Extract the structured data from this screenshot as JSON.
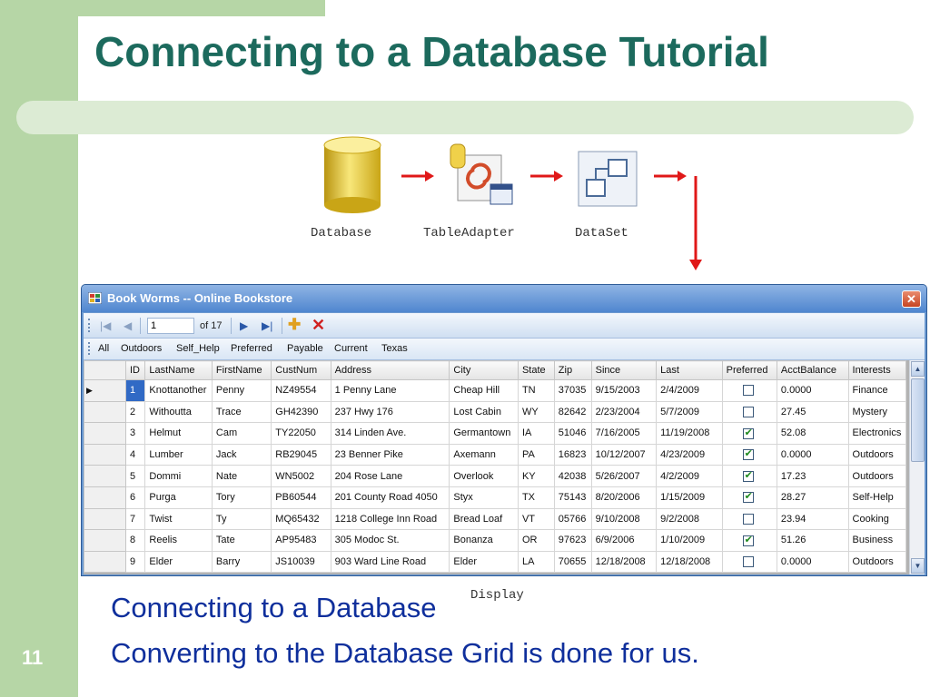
{
  "slide": {
    "title": "Connecting to a Database Tutorial",
    "page_number": "11",
    "bullets": [
      "Connecting to a Database",
      "Converting to the Database Grid is done for us."
    ]
  },
  "flow": {
    "database_label": "Database",
    "table_adapter_label": "TableAdapter",
    "dataset_label": "DataSet",
    "display_label": "Display",
    "arrow_color": "#e01818"
  },
  "window": {
    "title": "Book Worms -- Online Bookstore",
    "close_glyph": "✕",
    "navigator": {
      "position": "1",
      "count_text": "of 17"
    },
    "filters": [
      "All",
      "Outdoors",
      "Self_Help",
      "Preferred",
      "Payable",
      "Current",
      "Texas"
    ],
    "grid": {
      "columns": [
        "ID",
        "LastName",
        "FirstName",
        "CustNum",
        "Address",
        "City",
        "State",
        "Zip",
        "Since",
        "Last",
        "Preferred",
        "AcctBalance",
        "Interests"
      ],
      "rows": [
        {
          "id": "1",
          "last": "Knottanother",
          "first": "Penny",
          "cust": "NZ49554",
          "address": "1 Penny Lane",
          "city": "Cheap Hill",
          "state": "TN",
          "zip": "37035",
          "since": "9/15/2003",
          "lastdate": "2/4/2009",
          "preferred": false,
          "balance": "0.0000",
          "interests": "Finance"
        },
        {
          "id": "2",
          "last": "Withoutta",
          "first": "Trace",
          "cust": "GH42390",
          "address": "237 Hwy 176",
          "city": "Lost Cabin",
          "state": "WY",
          "zip": "82642",
          "since": "2/23/2004",
          "lastdate": "5/7/2009",
          "preferred": false,
          "balance": "27.45",
          "interests": "Mystery"
        },
        {
          "id": "3",
          "last": "Helmut",
          "first": "Cam",
          "cust": "TY22050",
          "address": "314 Linden Ave.",
          "city": "Germantown",
          "state": "IA",
          "zip": "51046",
          "since": "7/16/2005",
          "lastdate": "11/19/2008",
          "preferred": true,
          "balance": "52.08",
          "interests": "Electronics"
        },
        {
          "id": "4",
          "last": "Lumber",
          "first": "Jack",
          "cust": "RB29045",
          "address": "23 Benner Pike",
          "city": "Axemann",
          "state": "PA",
          "zip": "16823",
          "since": "10/12/2007",
          "lastdate": "4/23/2009",
          "preferred": true,
          "balance": "0.0000",
          "interests": "Outdoors"
        },
        {
          "id": "5",
          "last": "Dommi",
          "first": "Nate",
          "cust": "WN5002",
          "address": "204 Rose Lane",
          "city": "Overlook",
          "state": "KY",
          "zip": "42038",
          "since": "5/26/2007",
          "lastdate": "4/2/2009",
          "preferred": true,
          "balance": "17.23",
          "interests": "Outdoors"
        },
        {
          "id": "6",
          "last": "Purga",
          "first": "Tory",
          "cust": "PB60544",
          "address": "201 County Road 4050",
          "city": "Styx",
          "state": "TX",
          "zip": "75143",
          "since": "8/20/2006",
          "lastdate": "1/15/2009",
          "preferred": true,
          "balance": "28.27",
          "interests": "Self-Help"
        },
        {
          "id": "7",
          "last": "Twist",
          "first": "Ty",
          "cust": "MQ65432",
          "address": "1218 College Inn Road",
          "city": "Bread Loaf",
          "state": "VT",
          "zip": "05766",
          "since": "9/10/2008",
          "lastdate": "9/2/2008",
          "preferred": false,
          "balance": "23.94",
          "interests": "Cooking"
        },
        {
          "id": "8",
          "last": "Reelis",
          "first": "Tate",
          "cust": "AP95483",
          "address": "305 Modoc St.",
          "city": "Bonanza",
          "state": "OR",
          "zip": "97623",
          "since": "6/9/2006",
          "lastdate": "1/10/2009",
          "preferred": true,
          "balance": "51.26",
          "interests": "Business"
        },
        {
          "id": "9",
          "last": "Elder",
          "first": "Barry",
          "cust": "JS10039",
          "address": "903 Ward Line Road",
          "city": "Elder",
          "state": "LA",
          "zip": "70655",
          "since": "12/18/2008",
          "lastdate": "12/18/2008",
          "preferred": false,
          "balance": "0.0000",
          "interests": "Outdoors"
        }
      ]
    }
  },
  "colors": {
    "title": "#1c6a5d",
    "accent_green": "#b6d6a6",
    "bullet_text": "#0f2f9c",
    "window_title": "#4f86cf"
  }
}
